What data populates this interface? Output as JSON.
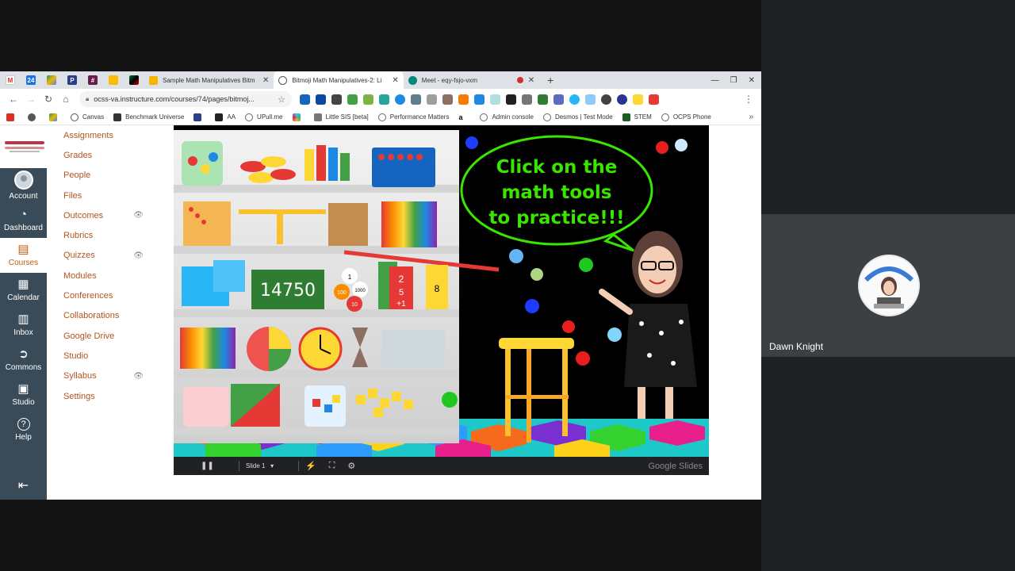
{
  "tabs": [
    {
      "title": "Sample Math Manipulatives Bitm",
      "active": false
    },
    {
      "title": "Bitmoji Math Manipulatives-2: Li",
      "active": true
    },
    {
      "title": "Meet - eqy-fsjo-vxm",
      "active": false
    }
  ],
  "pinned_tabs": [
    "gmail-icon",
    "calendar-icon",
    "drive-icon",
    "pear-deck-icon",
    "grid-icon",
    "keep-icon",
    "flag-icon"
  ],
  "address_bar": {
    "url": "ocss-va.instructure.com/courses/74/pages/bitmoj..."
  },
  "bookmarks": [
    {
      "label": "",
      "icon": "gmail-icon"
    },
    {
      "label": "",
      "icon": "web-icon"
    },
    {
      "label": "",
      "icon": "drive-icon"
    },
    {
      "label": "Canvas",
      "icon": "canvas-icon"
    },
    {
      "label": "Benchmark Universe",
      "icon": "benchmark-icon"
    },
    {
      "label": "",
      "icon": "pear-deck-icon"
    },
    {
      "label": "AA",
      "icon": "aa-icon"
    },
    {
      "label": "UPull.me",
      "icon": "globe-icon"
    },
    {
      "label": "",
      "icon": "slack-icon"
    },
    {
      "label": "Little SIS [beta]",
      "icon": "sis-icon"
    },
    {
      "label": "Performance Matters",
      "icon": "globe-icon"
    },
    {
      "label": "",
      "icon": "amazon-icon"
    },
    {
      "label": "Admin console",
      "icon": "globe-icon"
    },
    {
      "label": "Desmos | Test Mode",
      "icon": "globe-icon"
    },
    {
      "label": "STEM",
      "icon": "stem-icon"
    },
    {
      "label": "OCPS Phone",
      "icon": "globe-icon"
    }
  ],
  "global_nav": [
    {
      "label": "Account",
      "icon": "avatar-icon"
    },
    {
      "label": "Dashboard",
      "icon": "dashboard-icon"
    },
    {
      "label": "Courses",
      "icon": "courses-icon",
      "active": true
    },
    {
      "label": "Calendar",
      "icon": "calendar-icon"
    },
    {
      "label": "Inbox",
      "icon": "inbox-icon"
    },
    {
      "label": "Commons",
      "icon": "commons-icon"
    },
    {
      "label": "Studio",
      "icon": "studio-icon"
    },
    {
      "label": "Help",
      "icon": "help-icon"
    }
  ],
  "course_nav": [
    {
      "label": "Assignments",
      "hidden": false
    },
    {
      "label": "Grades",
      "hidden": false
    },
    {
      "label": "People",
      "hidden": false
    },
    {
      "label": "Files",
      "hidden": false
    },
    {
      "label": "Outcomes",
      "hidden": true
    },
    {
      "label": "Rubrics",
      "hidden": false
    },
    {
      "label": "Quizzes",
      "hidden": true
    },
    {
      "label": "Modules",
      "hidden": false
    },
    {
      "label": "Conferences",
      "hidden": false
    },
    {
      "label": "Collaborations",
      "hidden": false
    },
    {
      "label": "Google Drive",
      "hidden": false
    },
    {
      "label": "Studio",
      "hidden": false
    },
    {
      "label": "Syllabus",
      "hidden": true
    },
    {
      "label": "Settings",
      "hidden": false
    }
  ],
  "slide": {
    "bubble_lines": [
      "Click on the",
      "math tools",
      "to practice!!!"
    ],
    "manipulative_labels": [
      "14750",
      "100",
      "1000",
      "10",
      "1",
      "2",
      "5",
      "+1",
      "8"
    ],
    "control_slide_label": "Slide 1",
    "brand": "Google Slides"
  },
  "meet": {
    "participant_name": "Dawn Knight",
    "avatar_caption": "working from home"
  },
  "colors": {
    "canvas_nav": "#394b58",
    "canvas_link": "#b3541e",
    "bubble_text": "#39e600",
    "meet_bg": "#202124"
  }
}
